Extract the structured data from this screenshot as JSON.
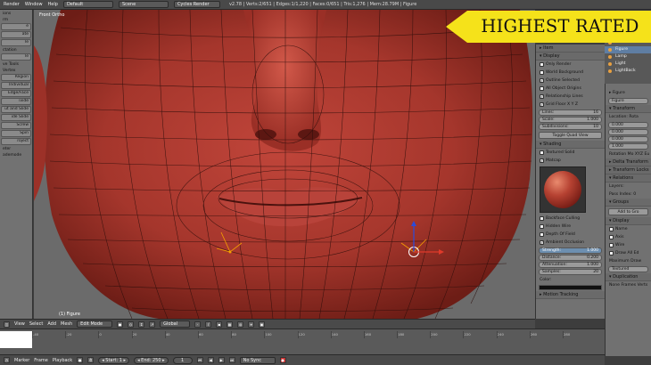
{
  "app": {
    "menus": [
      "Render",
      "Window",
      "Help"
    ],
    "layout": "Default",
    "scene": "Scene",
    "engine": "Cycles Render",
    "stats": "v2.78 | Verts:2/651 | Edges:1/1,220 | Faces:0/651 | Tris:1,276 | Mem:28.79M | Figure"
  },
  "banner": {
    "text": "HIGHEST RATED",
    "color": "#f5e21a"
  },
  "toolshelf": {
    "items": [
      {
        "kind": "label",
        "text": "ions"
      },
      {
        "kind": "label",
        "text": "rm"
      },
      {
        "kind": "button",
        "text": "e"
      },
      {
        "kind": "button",
        "text": "ate"
      },
      {
        "kind": "button",
        "text": "le"
      },
      {
        "kind": "label",
        "text": "ctation"
      },
      {
        "kind": "button",
        "text": "le"
      },
      {
        "kind": "label",
        "text": "ve Tools"
      },
      {
        "kind": "label",
        "text": "Vertex"
      },
      {
        "kind": "button",
        "text": "Region"
      },
      {
        "kind": "button",
        "text": "Individual"
      },
      {
        "kind": "button",
        "text": "Edge/Face"
      },
      {
        "kind": "button",
        "text": "ivide"
      },
      {
        "kind": "button",
        "text": "ut and Slide"
      },
      {
        "kind": "button",
        "text": "ide Slide"
      },
      {
        "kind": "button",
        "text": "Screw"
      },
      {
        "kind": "button",
        "text": "Spin"
      },
      {
        "kind": "button",
        "text": "roject"
      },
      {
        "kind": "label",
        "text": "eter"
      },
      {
        "kind": "label",
        "text": "ademode"
      }
    ]
  },
  "viewport": {
    "label": "Front Ortho",
    "object_label": "(1) Figure"
  },
  "properties": {
    "items": [
      {
        "kind": "head",
        "text": "▸ Item"
      },
      {
        "kind": "head",
        "text": "▾ Display"
      },
      {
        "kind": "check",
        "text": "Only Render",
        "on": false
      },
      {
        "kind": "check",
        "text": "World Background",
        "on": false
      },
      {
        "kind": "check",
        "text": "Outline Selected",
        "on": true
      },
      {
        "kind": "check",
        "text": "All Object Origins",
        "on": false
      },
      {
        "kind": "check",
        "text": "Relationship Lines",
        "on": true
      },
      {
        "kind": "check",
        "text": "Grid Floor  X  Y  Z",
        "on": true
      },
      {
        "kind": "field",
        "text": "Lines:",
        "value": "16"
      },
      {
        "kind": "field",
        "text": "Scale:",
        "value": "1.000"
      },
      {
        "kind": "field",
        "text": "Subdivisions:",
        "value": "10"
      },
      {
        "kind": "button",
        "text": "Toggle Quad View"
      },
      {
        "kind": "head",
        "text": "▾ Shading"
      },
      {
        "kind": "check",
        "text": "Textured Solid",
        "on": false
      },
      {
        "kind": "check",
        "text": "Matcap",
        "on": true
      },
      {
        "kind": "matcap",
        "text": ""
      },
      {
        "kind": "check",
        "text": "Backface Culling",
        "on": false
      },
      {
        "kind": "check",
        "text": "Hidden Wire",
        "on": false
      },
      {
        "kind": "check",
        "text": "Depth Of Field",
        "on": false
      },
      {
        "kind": "check",
        "text": "Ambient Occlusion",
        "on": true
      },
      {
        "kind": "field",
        "text": "Strength:",
        "value": "1.000",
        "hl": true
      },
      {
        "kind": "field",
        "text": "Distance:",
        "value": "0.200"
      },
      {
        "kind": "field",
        "text": "Attenuation:",
        "value": "1.000"
      },
      {
        "kind": "field",
        "text": "Samples:",
        "value": "20"
      },
      {
        "kind": "label",
        "text": "Color:"
      },
      {
        "kind": "color",
        "text": ""
      },
      {
        "kind": "head",
        "text": "▸ Motion Tracking"
      }
    ]
  },
  "outliner": {
    "items": [
      {
        "text": "Camera",
        "sel": false
      },
      {
        "text": "Figure",
        "sel": true
      },
      {
        "text": "Lamp",
        "sel": false
      },
      {
        "text": "Light",
        "sel": false
      },
      {
        "text": "LightBack",
        "sel": false
      }
    ]
  },
  "object_props": {
    "items": [
      {
        "kind": "row",
        "text": "▸ Figure"
      },
      {
        "kind": "field",
        "text": "Figure",
        "value": ""
      },
      {
        "kind": "head",
        "text": "▾ Transform"
      },
      {
        "kind": "row",
        "text": "Location:   Rota"
      },
      {
        "kind": "field",
        "text": "0.000",
        "value": ""
      },
      {
        "kind": "field",
        "text": "0.000",
        "value": ""
      },
      {
        "kind": "field",
        "text": "0.000",
        "value": ""
      },
      {
        "kind": "field",
        "text": "1.000",
        "value": ""
      },
      {
        "kind": "row",
        "text": "Rotation Mo  XYZ Eu"
      },
      {
        "kind": "head",
        "text": "▸ Delta Transform"
      },
      {
        "kind": "head",
        "text": "▸ Transform Locks"
      },
      {
        "kind": "head",
        "text": "▾ Relations"
      },
      {
        "kind": "row",
        "text": "Layers:"
      },
      {
        "kind": "row",
        "text": "Pass Index: 0"
      },
      {
        "kind": "head",
        "text": "▾ Groups"
      },
      {
        "kind": "button",
        "text": "Add to Gro"
      },
      {
        "kind": "head",
        "text": "▾ Display"
      },
      {
        "kind": "check",
        "text": "Name",
        "on": false
      },
      {
        "kind": "check",
        "text": "Axis",
        "on": false
      },
      {
        "kind": "check",
        "text": "Wire",
        "on": false
      },
      {
        "kind": "check",
        "text": "Draw All Ed",
        "on": false
      },
      {
        "kind": "row",
        "text": "Maximum Draw"
      },
      {
        "kind": "field",
        "text": "Textured",
        "value": ""
      },
      {
        "kind": "head",
        "text": "▾ Duplication"
      },
      {
        "kind": "row",
        "text": "None  Frames  Verts"
      }
    ]
  },
  "header": {
    "items": [
      "View",
      "Select",
      "Add",
      "Mesh"
    ],
    "mode": "Edit Mode",
    "orientation": "Global"
  },
  "timeline": {
    "labels": [
      "Marker",
      "Frame",
      "Playback"
    ],
    "start": "◂ Start:     1 ▸",
    "end": "◂ End:     250 ▸",
    "current": "1",
    "sync": "No Sync",
    "ticks": [
      "-40",
      "-20",
      "0",
      "20",
      "40",
      "60",
      "80",
      "100",
      "120",
      "140",
      "160",
      "180",
      "200",
      "220",
      "240",
      "260",
      "280"
    ]
  }
}
